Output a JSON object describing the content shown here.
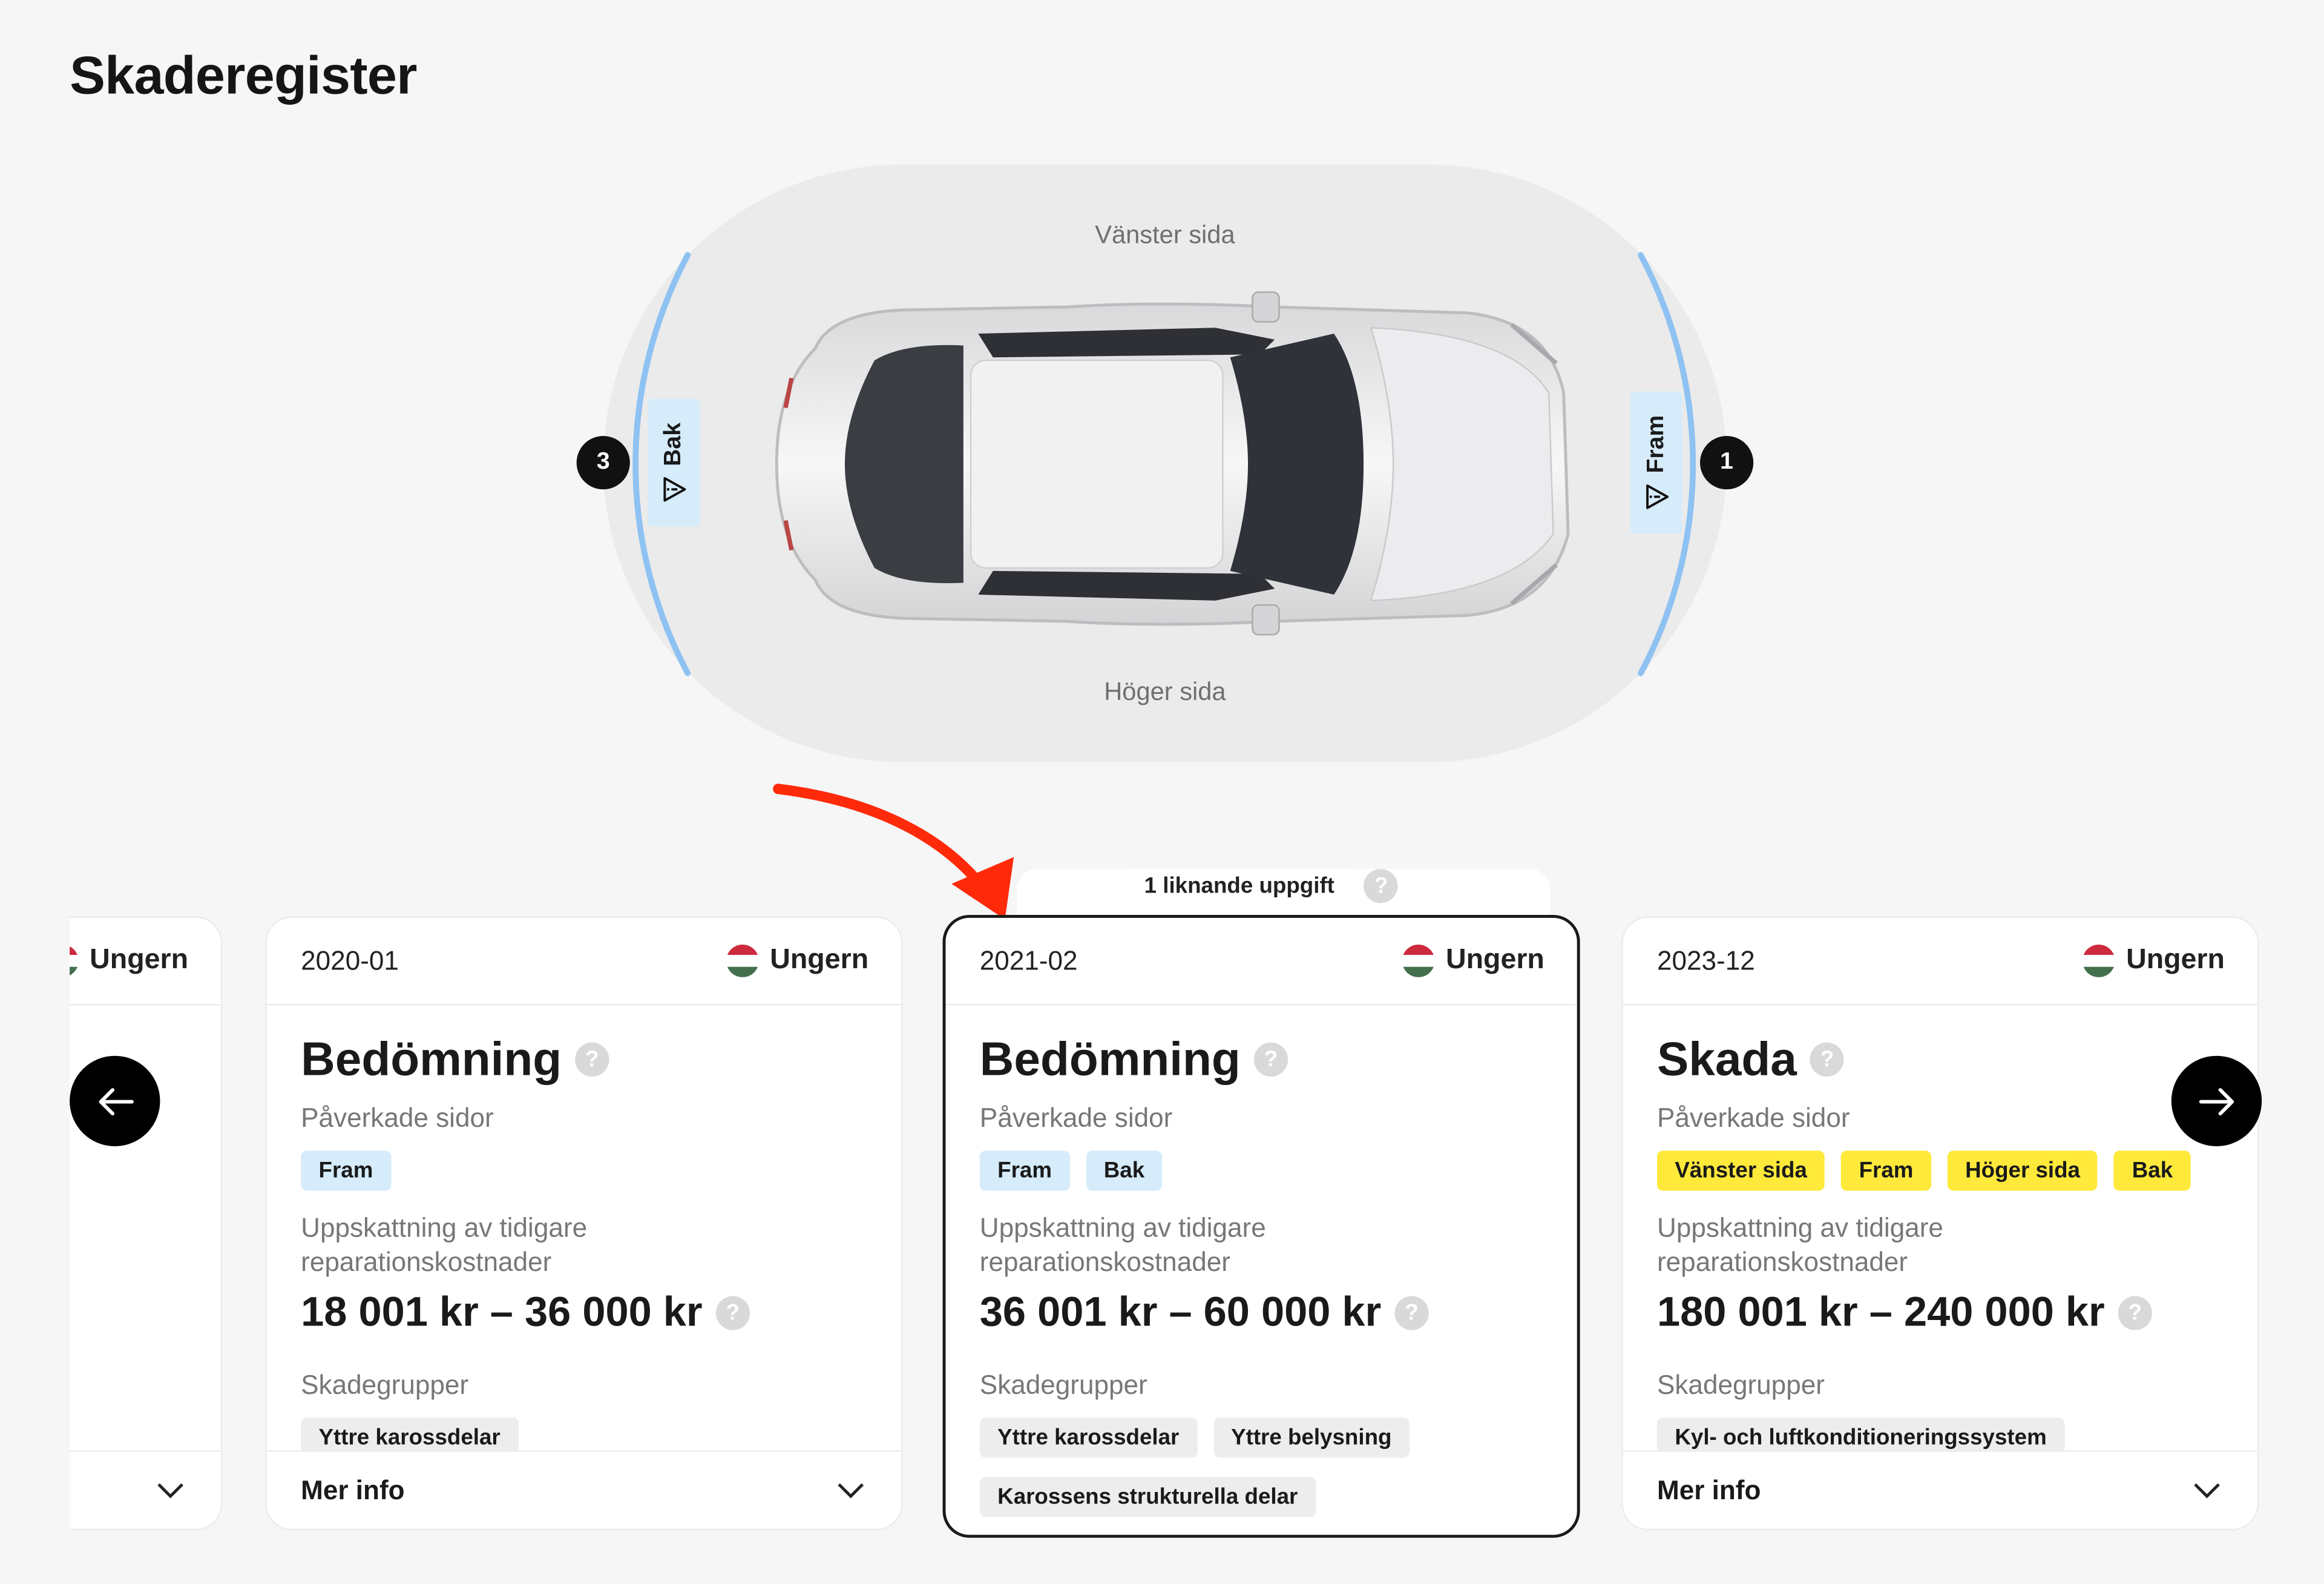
{
  "page": {
    "title": "Skaderegister"
  },
  "diagram": {
    "left_side_label": "Vänster sida",
    "right_side_label": "Höger sida",
    "rear_tag": "Bak",
    "front_tag": "Fram",
    "rear_count": "3",
    "front_count": "1",
    "highlight_color": "#8ec2f2"
  },
  "similar_badge": {
    "label": "1 liknande uppgift",
    "help": "?"
  },
  "cards": [
    {
      "date": "",
      "country": "Ungern",
      "footer": ""
    },
    {
      "date": "2020-01",
      "country": "Ungern",
      "type": "Bedömning",
      "affected_label": "Påverkade sidor",
      "sides": [
        "Fram"
      ],
      "cost_label": "Uppskattning av tidigare reparationskostnader",
      "cost": "18 001 kr – 36 000 kr",
      "groups_label": "Skadegrupper",
      "groups": [
        "Yttre karossdelar"
      ],
      "footer": "Mer info"
    },
    {
      "date": "2021-02",
      "country": "Ungern",
      "type": "Bedömning",
      "affected_label": "Påverkade sidor",
      "sides": [
        "Fram",
        "Bak"
      ],
      "cost_label": "Uppskattning av tidigare reparationskostnader",
      "cost": "36 001 kr – 60 000 kr",
      "groups_label": "Skadegrupper",
      "groups": [
        "Yttre karossdelar",
        "Yttre belysning",
        "Karossens strukturella delar"
      ],
      "footer": ""
    },
    {
      "date": "2023-12",
      "country": "Ungern",
      "type": "Skada",
      "affected_label": "Påverkade sidor",
      "sides": [
        "Vänster sida",
        "Fram",
        "Höger sida",
        "Bak"
      ],
      "cost_label": "Uppskattning av tidigare reparationskostnader",
      "cost": "180 001 kr – 240 000 kr",
      "groups_label": "Skadegrupper",
      "groups": [
        "Kyl- och luftkonditioneringssystem"
      ],
      "footer": "Mer info"
    }
  ],
  "nav": {
    "prev_icon": "arrow-left-icon",
    "next_icon": "arrow-right-icon"
  },
  "colors": {
    "flag_red": "#cd2a3e",
    "flag_white": "#ffffff",
    "flag_green": "#436f4d",
    "annotation_arrow": "#ff2a0a"
  }
}
